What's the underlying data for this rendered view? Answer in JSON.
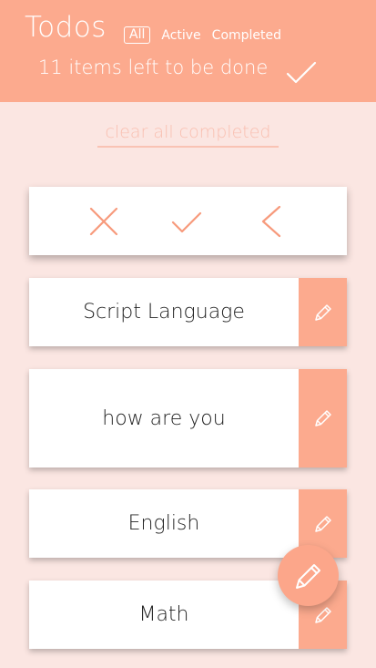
{
  "header": {
    "title": "Todos",
    "filters": [
      "All",
      "Active",
      "Completed"
    ],
    "active_filter": "All",
    "status_text": "11 items left to be done"
  },
  "clear_completed_label": "clear all completed",
  "action_bar": {
    "icons": [
      "close-icon",
      "check-icon",
      "chevron-left-icon"
    ]
  },
  "todos": [
    {
      "text": "Script Language"
    },
    {
      "text": "how are you"
    },
    {
      "text": "English"
    },
    {
      "text": "Math"
    }
  ],
  "colors": {
    "accent": "#fcaa8e",
    "background": "#fbe6e2",
    "icon_stroke": "#f79a7c"
  }
}
